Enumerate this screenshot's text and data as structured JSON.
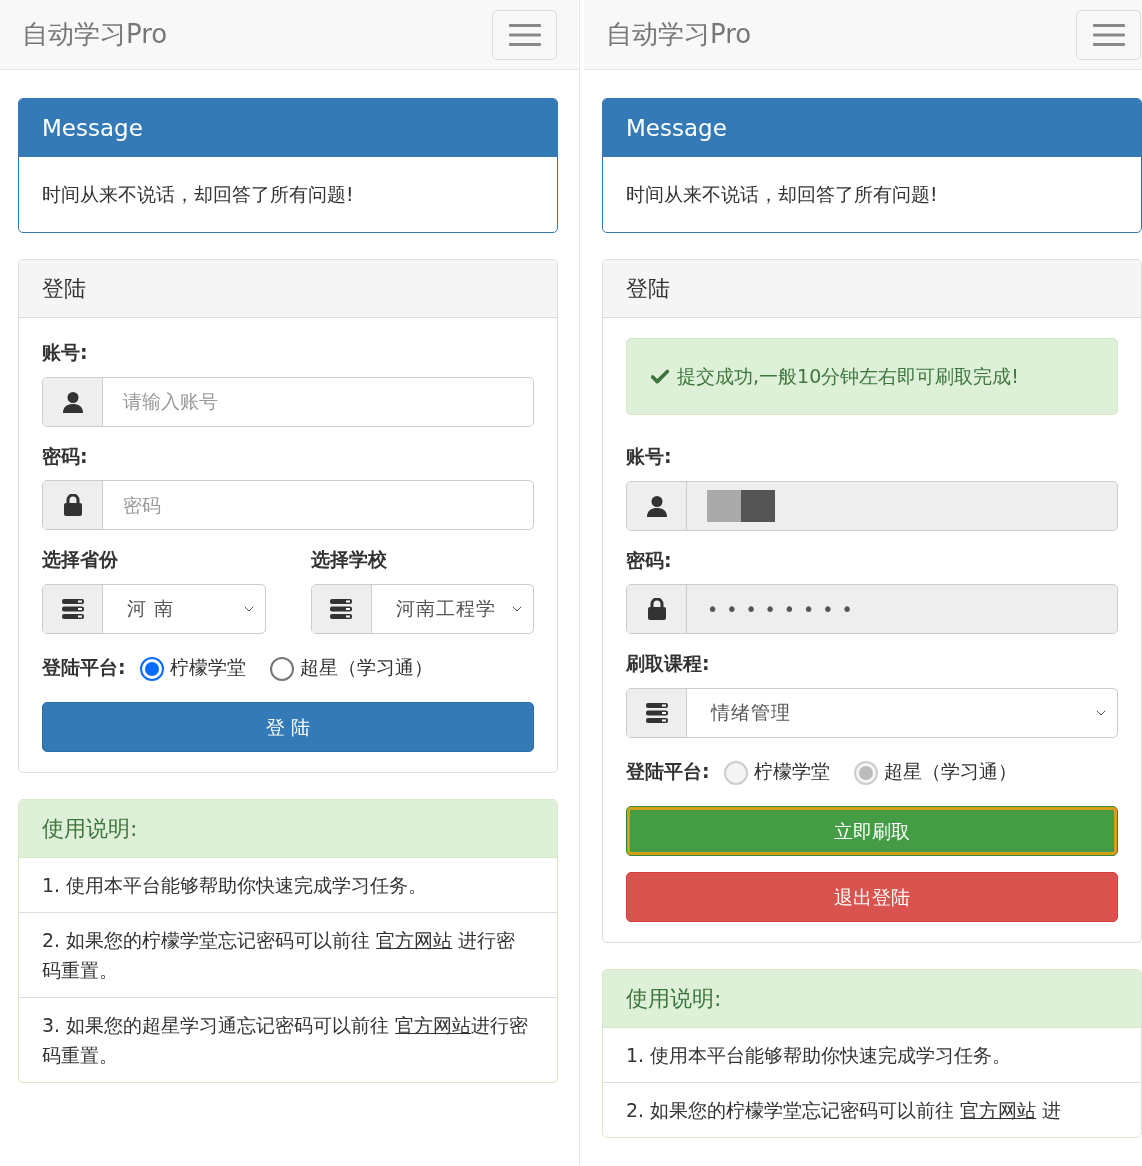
{
  "screens": [
    {
      "brand": "自动学习Pro",
      "message": {
        "title": "Message",
        "text": "时间从来不说话，却回答了所有问题!"
      },
      "login": {
        "title": "登陆",
        "fields": [
          {
            "kind": "account",
            "label": "账号:",
            "placeholder": "请输入账号",
            "disabled": false
          },
          {
            "kind": "password",
            "label": "密码:",
            "placeholder": "密码",
            "disabled": false
          },
          {
            "kind": "select_pair",
            "selects": [
              {
                "label": "选择省份",
                "value": "河 南"
              },
              {
                "label": "选择学校",
                "value": "河南工程学"
              }
            ]
          }
        ],
        "platform": {
          "label": "登陆平台:",
          "disabled": false,
          "options": [
            {
              "label": "柠檬学堂",
              "selected": true
            },
            {
              "label": "超星（学习通）",
              "selected": false
            }
          ]
        },
        "buttons": [
          {
            "kind": "primary",
            "label": "登 陆",
            "focused": false
          }
        ]
      },
      "instructions": {
        "title": "使用说明:",
        "items": [
          {
            "before": "1. 使用本平台能够帮助你快速完成学习任务。"
          },
          {
            "before": "2. 如果您的柠檬学堂忘记密码可以前往 ",
            "link": "官方网站",
            "after": " 进行密码重置。"
          },
          {
            "before": "3. 如果您的超星学习通忘记密码可以前往 ",
            "link": "官方网站",
            "after": "进行密码重置。"
          }
        ]
      }
    },
    {
      "brand": "自动学习Pro",
      "message": {
        "title": "Message",
        "text": "时间从来不说话，却回答了所有问题!"
      },
      "login": {
        "title": "登陆",
        "alert": "提交成功,一般10分钟左右即可刷取完成!",
        "fields": [
          {
            "kind": "account",
            "label": "账号:",
            "redacted": true,
            "disabled": true
          },
          {
            "kind": "password",
            "label": "密码:",
            "value": "••••••••",
            "disabled": true
          },
          {
            "kind": "select",
            "label": "刷取课程:",
            "value": "情绪管理"
          }
        ],
        "platform": {
          "label": "登陆平台:",
          "disabled": true,
          "options": [
            {
              "label": "柠檬学堂",
              "selected": false
            },
            {
              "label": "超星（学习通）",
              "selected": true
            }
          ]
        },
        "buttons": [
          {
            "kind": "success",
            "label": "立即刷取",
            "focused": true
          },
          {
            "kind": "danger",
            "label": "退出登陆",
            "focused": false
          }
        ]
      },
      "instructions": {
        "title": "使用说明:",
        "items": [
          {
            "before": "1. 使用本平台能够帮助你快速完成学习任务。"
          },
          {
            "before": "2. 如果您的柠檬学堂忘记密码可以前往 ",
            "link": "官方网站",
            "after": " 进"
          }
        ]
      }
    }
  ]
}
